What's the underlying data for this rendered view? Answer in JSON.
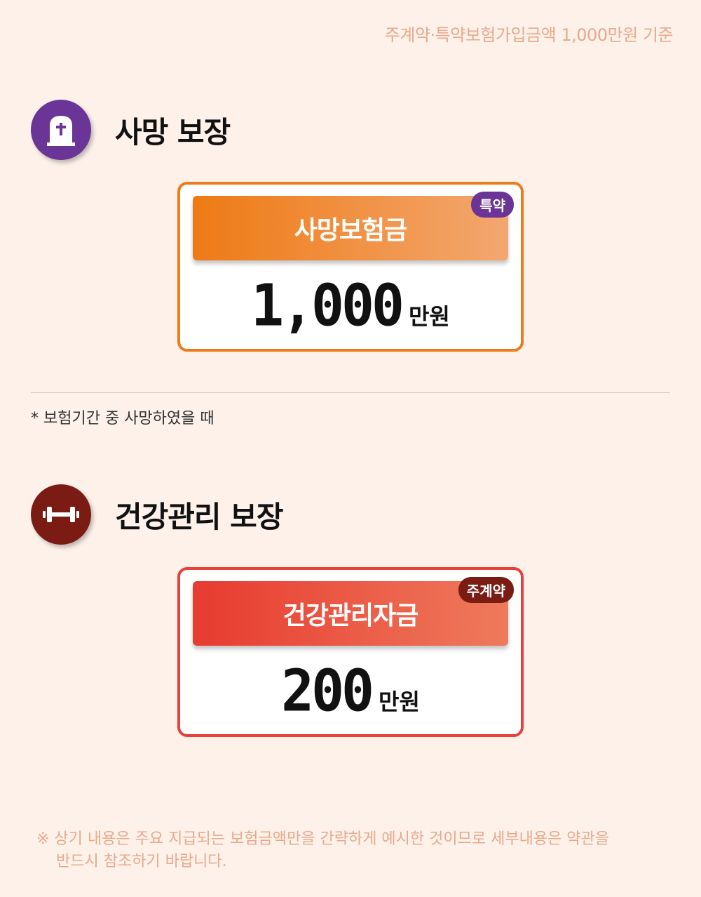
{
  "top_note": "주계약·특약보험가입금액 1,000만원 기준",
  "sections": [
    {
      "title": "사망 보장",
      "icon": "tombstone-icon",
      "icon_bg": "#6a3596",
      "card": {
        "label": "사망보험금",
        "badge": "특약",
        "badge_color": "#6a3596",
        "amount": "1,000",
        "unit": "만원",
        "border_color": "#ef7a1a",
        "gradient": [
          "#ee7a14",
          "#f3a770"
        ]
      }
    },
    {
      "title": "건강관리 보장",
      "icon": "dumbbell-icon",
      "icon_bg": "#7b1c14",
      "card": {
        "label": "건강관리자금",
        "badge": "주계약",
        "badge_color": "#7b1c14",
        "amount": "200",
        "unit": "만원",
        "border_color": "#e8403a",
        "gradient": [
          "#e83b30",
          "#ee7a5c"
        ]
      }
    }
  ],
  "footnote": "* 보험기간 중 사망하였을 때",
  "bottom_note": {
    "line1": "※ 상기 내용은 주요 지급되는 보험금액만을 간략하게 예시한 것이므로 세부내용은 약관을",
    "line2": "반드시 참조하기 바랍니다."
  }
}
